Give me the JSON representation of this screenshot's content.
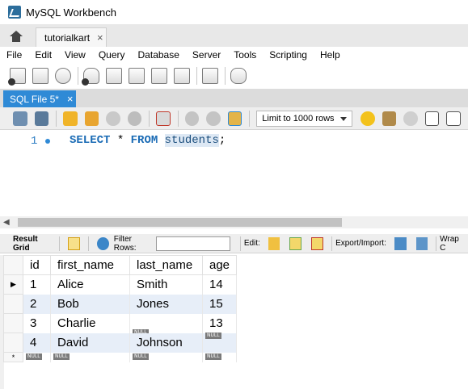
{
  "window": {
    "title": "MySQL Workbench"
  },
  "connection_tab": {
    "label": "tutorialkart",
    "close": "×"
  },
  "menu": [
    "File",
    "Edit",
    "View",
    "Query",
    "Database",
    "Server",
    "Tools",
    "Scripting",
    "Help"
  ],
  "sql_tab": {
    "label": "SQL File 5*",
    "close": "×"
  },
  "editor": {
    "limit_value": "Limit to 1000 rows",
    "line_number": "1",
    "tokens": {
      "select": "SELECT",
      "star": " * ",
      "from": "FROM",
      "space": " ",
      "table": "students",
      "semicolon": ";"
    }
  },
  "result_toolbar": {
    "result_grid": "Result Grid",
    "filter_rows": "Filter Rows:",
    "edit": "Edit:",
    "export_import": "Export/Import:",
    "wrap": "Wrap C"
  },
  "grid": {
    "columns": [
      "id",
      "first_name",
      "last_name",
      "age"
    ],
    "null_label": "NULL",
    "rows": [
      {
        "id": "1",
        "first_name": "Alice",
        "last_name": "Smith",
        "age": "14"
      },
      {
        "id": "2",
        "first_name": "Bob",
        "last_name": "Jones",
        "age": "15"
      },
      {
        "id": "3",
        "first_name": "Charlie",
        "last_name": "NULL",
        "age": "13"
      },
      {
        "id": "4",
        "first_name": "David",
        "last_name": "Johnson",
        "age": "NULL"
      }
    ],
    "current_row_marker": "▶",
    "new_row_marker": "*"
  },
  "colors": {
    "accent": "#2f8ad6",
    "keyword": "#1a6bb5",
    "row_alt": "#e7eef8",
    "null_badge": "#7a7a7a"
  }
}
